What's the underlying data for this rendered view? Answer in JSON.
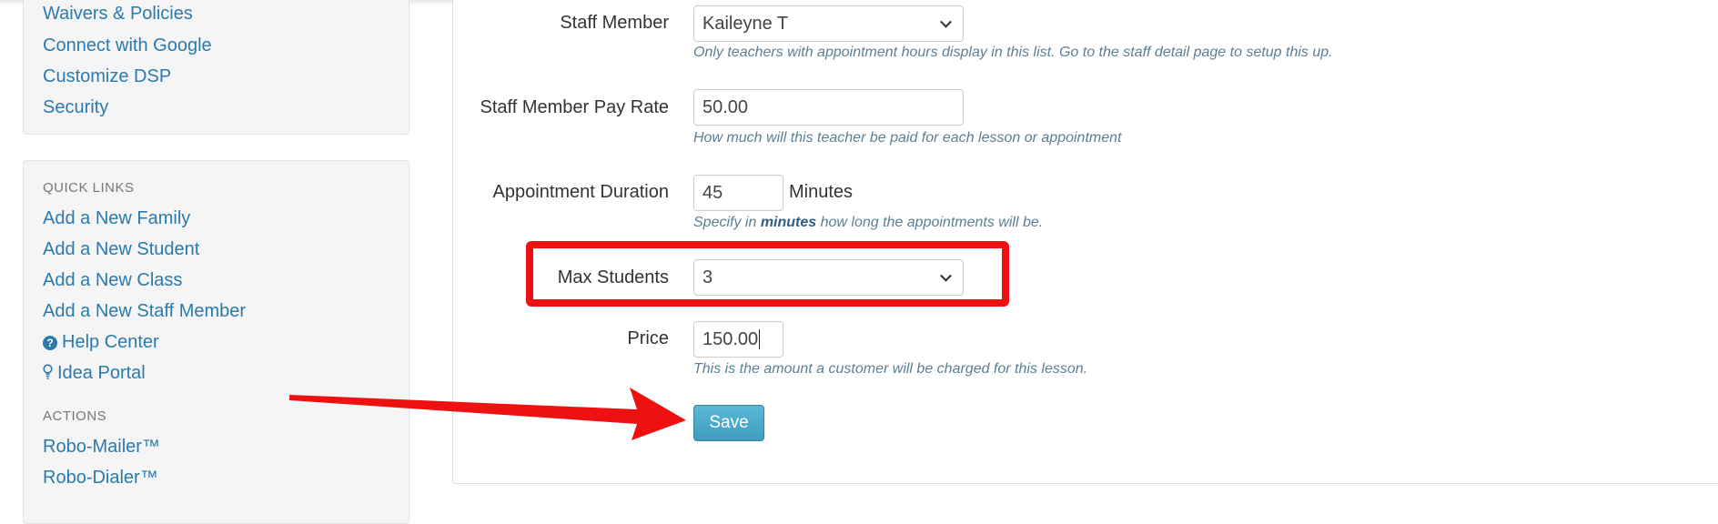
{
  "sidebar": {
    "top_links": [
      "Waivers & Policies",
      "Connect with Google",
      "Customize DSP",
      "Security"
    ],
    "quick_links_heading": "QUICK LINKS",
    "quick_links": [
      "Add a New Family",
      "Add a New Student",
      "Add a New Class",
      "Add a New Staff Member"
    ],
    "help_center": "Help Center",
    "idea_portal": "Idea Portal",
    "actions_heading": "ACTIONS",
    "actions": [
      "Robo-Mailer™",
      "Robo-Dialer™"
    ]
  },
  "form": {
    "staff_member": {
      "label": "Staff Member",
      "value": "Kaileyne T",
      "help": "Only teachers with appointment hours display in this list. Go to the staff detail page to setup this up."
    },
    "pay_rate": {
      "label": "Staff Member Pay Rate",
      "value": "50.00",
      "help": "How much will this teacher be paid for each lesson or appointment"
    },
    "duration": {
      "label": "Appointment Duration",
      "value": "45",
      "units": "Minutes",
      "help_prefix": "Specify in ",
      "help_bold": "minutes",
      "help_suffix": " how long the appointments will be."
    },
    "max_students": {
      "label": "Max Students",
      "value": "3"
    },
    "price": {
      "label": "Price",
      "value": "150.00",
      "help": "This is the amount a customer will be charged for this lesson."
    },
    "save_label": "Save"
  },
  "annotations": {
    "highlight_color": "#ee1111",
    "arrow_color": "#ee1111"
  }
}
